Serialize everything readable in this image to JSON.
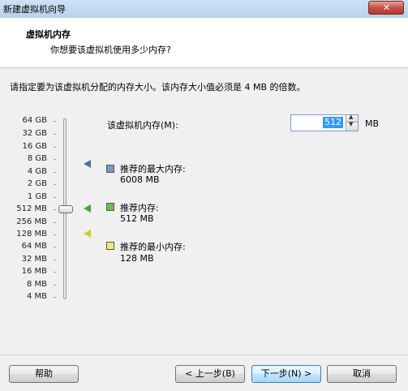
{
  "window": {
    "title": "新建虚拟机向导",
    "close_glyph": "✕"
  },
  "header": {
    "title": "虚拟机内存",
    "subtitle": "你想要该虚拟机使用多少内存?"
  },
  "instruction": "请指定要为该虚拟机分配的内存大小。该内存大小值必须是 4 MB 的倍数。",
  "scale": [
    "64 GB",
    "32 GB",
    "16 GB",
    "8 GB",
    "4 GB",
    "2 GB",
    "1 GB",
    "512 MB",
    "256 MB",
    "128 MB",
    "64 MB",
    "32 MB",
    "16 MB",
    "8 MB",
    "4 MB"
  ],
  "slider": {
    "selected": "512 MB"
  },
  "memory": {
    "label": "该虚拟机内存(M):",
    "value": "512",
    "unit": "MB",
    "up_glyph": "▲",
    "down_glyph": "▼"
  },
  "legend": {
    "max_label": "推荐的最大内存:",
    "max_value": "6008 MB",
    "rec_label": "推荐内存:",
    "rec_value": "512 MB",
    "min_label": "推荐的最小内存:",
    "min_value": "128 MB"
  },
  "colors": {
    "max": "#7f97c6",
    "recommended": "#6dc050",
    "min": "#efef6a"
  },
  "buttons": {
    "help": "帮助",
    "back": "< 上一步(B)",
    "next": "下一步(N) >",
    "cancel": "取消"
  }
}
